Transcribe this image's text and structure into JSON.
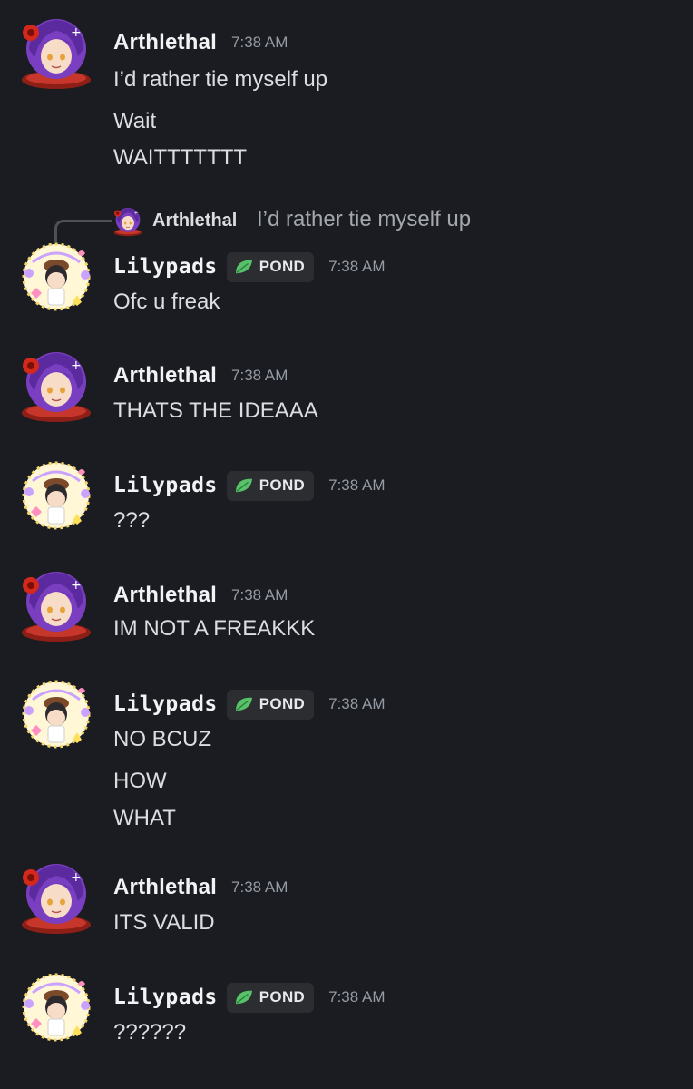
{
  "users": {
    "arthlethal": {
      "name": "Arthlethal"
    },
    "lilypads": {
      "name": "Lilypads",
      "tag_label": "POND"
    }
  },
  "reply": {
    "author": "Arthlethal",
    "text": "I’d rather tie myself up"
  },
  "messages": [
    {
      "author": "Arthlethal",
      "time": "7:38 AM",
      "lines": [
        "I’d rather tie myself up",
        "Wait",
        "WAITTTTTTT"
      ]
    },
    {
      "author": "Lilypads",
      "time": "7:38 AM",
      "tag": "POND",
      "lines": [
        "Ofc u freak"
      ]
    },
    {
      "author": "Arthlethal",
      "time": "7:38 AM",
      "lines": [
        "THATS THE IDEAAA"
      ]
    },
    {
      "author": "Lilypads",
      "time": "7:38 AM",
      "tag": "POND",
      "lines": [
        "???"
      ]
    },
    {
      "author": "Arthlethal",
      "time": "7:38 AM",
      "lines": [
        "IM NOT A FREAKKK"
      ]
    },
    {
      "author": "Lilypads",
      "time": "7:38 AM",
      "tag": "POND",
      "lines": [
        "NO BCUZ",
        "HOW",
        "WHAT"
      ]
    },
    {
      "author": "Arthlethal",
      "time": "7:38 AM",
      "lines": [
        "ITS VALID"
      ]
    },
    {
      "author": "Lilypads",
      "time": "7:38 AM",
      "tag": "POND",
      "lines": [
        "??????"
      ]
    }
  ],
  "colors": {
    "background": "#1b1c21",
    "text": "#dbdee1",
    "timestamp": "#949ba4",
    "tag_bg": "#2b2d31",
    "leaf": "#57c26a"
  }
}
